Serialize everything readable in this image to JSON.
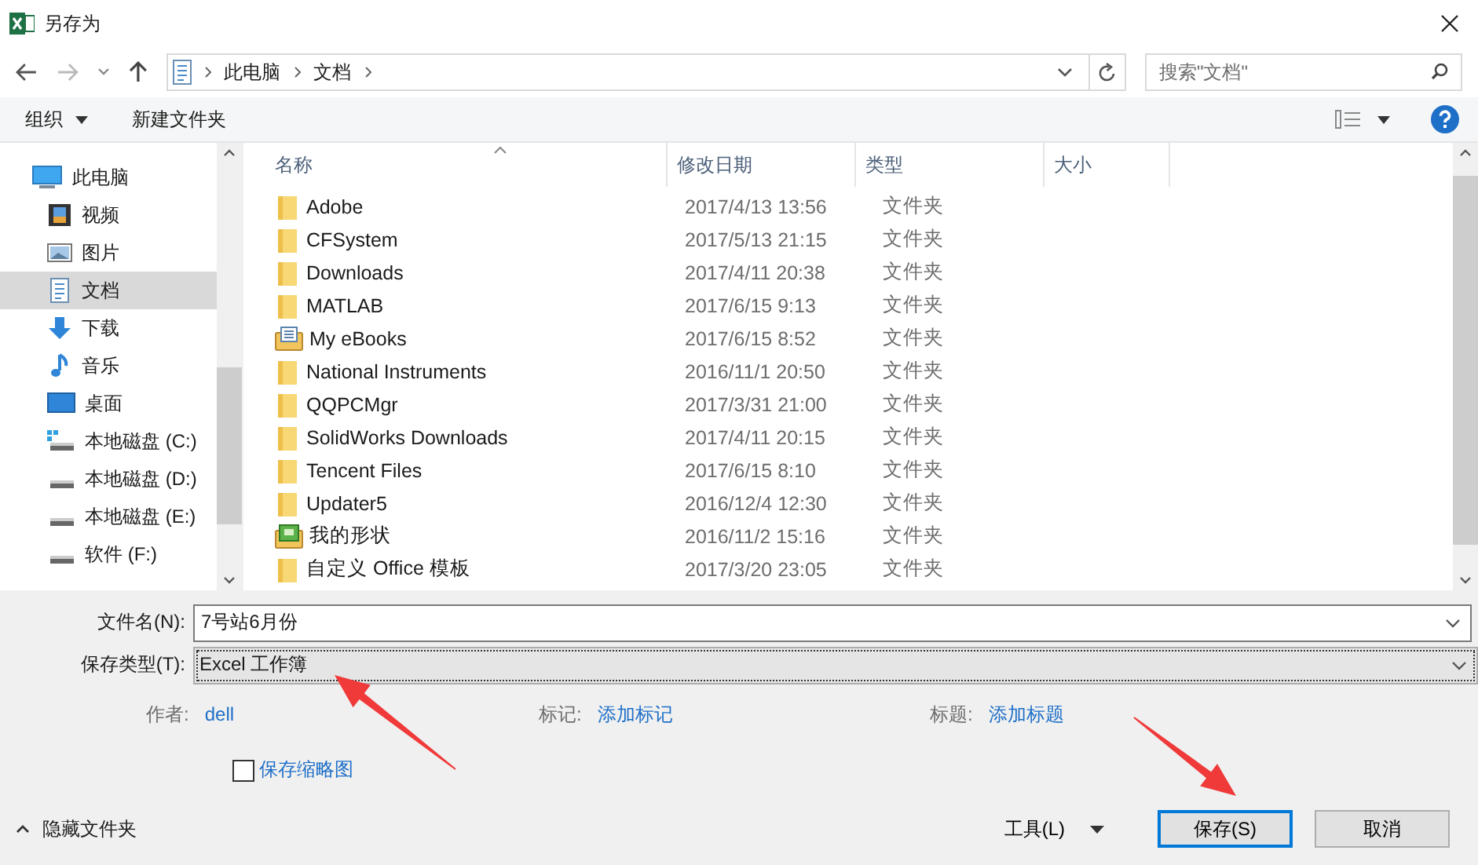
{
  "window": {
    "title": "另存为"
  },
  "nav": {
    "breadcrumb": [
      "此电脑",
      "文档"
    ],
    "search": {
      "placeholder": "搜索\"文档\""
    }
  },
  "toolbar": {
    "organize": "组织",
    "new_folder": "新建文件夹"
  },
  "sidebar": {
    "items": [
      {
        "label": "此电脑",
        "kind": "pc",
        "selected": false,
        "children": [
          {
            "label": "视频",
            "kind": "video",
            "selected": false
          },
          {
            "label": "图片",
            "kind": "picture",
            "selected": false
          },
          {
            "label": "文档",
            "kind": "document",
            "selected": true
          },
          {
            "label": "下载",
            "kind": "download",
            "selected": false
          },
          {
            "label": "音乐",
            "kind": "music",
            "selected": false
          },
          {
            "label": "桌面",
            "kind": "desktop",
            "selected": false
          },
          {
            "label": "本地磁盘 (C:)",
            "kind": "system-drive",
            "selected": false
          },
          {
            "label": "本地磁盘 (D:)",
            "kind": "drive",
            "selected": false
          },
          {
            "label": "本地磁盘 (E:)",
            "kind": "drive",
            "selected": false
          },
          {
            "label": "软件 (F:)",
            "kind": "drive",
            "selected": false
          }
        ]
      }
    ]
  },
  "table": {
    "columns": [
      "名称",
      "修改日期",
      "类型",
      "大小"
    ],
    "rows": [
      {
        "name": "Adobe",
        "date": "2017/4/13 13:56",
        "type": "文件夹",
        "kind": "folder"
      },
      {
        "name": "CFSystem",
        "date": "2017/5/13 21:15",
        "type": "文件夹",
        "kind": "folder"
      },
      {
        "name": "Downloads",
        "date": "2017/4/11 20:38",
        "type": "文件夹",
        "kind": "folder"
      },
      {
        "name": "MATLAB",
        "date": "2017/6/15 9:13",
        "type": "文件夹",
        "kind": "folder"
      },
      {
        "name": "My eBooks",
        "date": "2017/6/15 8:52",
        "type": "文件夹",
        "kind": "book-folder"
      },
      {
        "name": "National Instruments",
        "date": "2016/11/1 20:50",
        "type": "文件夹",
        "kind": "folder"
      },
      {
        "name": "QQPCMgr",
        "date": "2017/3/31 21:00",
        "type": "文件夹",
        "kind": "folder"
      },
      {
        "name": "SolidWorks Downloads",
        "date": "2017/4/11 20:15",
        "type": "文件夹",
        "kind": "folder"
      },
      {
        "name": "Tencent Files",
        "date": "2017/6/15 8:10",
        "type": "文件夹",
        "kind": "folder"
      },
      {
        "name": "Updater5",
        "date": "2016/12/4 12:30",
        "type": "文件夹",
        "kind": "folder"
      },
      {
        "name": "我的形状",
        "date": "2016/11/2 15:16",
        "type": "文件夹",
        "kind": "shapes-folder"
      },
      {
        "name": "自定义 Office 模板",
        "date": "2017/3/20 23:05",
        "type": "文件夹",
        "kind": "folder"
      }
    ]
  },
  "form": {
    "filename": {
      "label": "文件名(N):",
      "value": "7号站6月份"
    },
    "filetype": {
      "label": "保存类型(T):",
      "value": "Excel 工作簿"
    },
    "meta": [
      {
        "label": "作者:",
        "value": "dell"
      },
      {
        "label": "标记:",
        "value": "添加标记"
      },
      {
        "label": "标题:",
        "value": "添加标题"
      }
    ],
    "thumbnail": {
      "label": "保存缩略图",
      "checked": false
    }
  },
  "footer": {
    "hide_folders": "隐藏文件夹",
    "tools": "工具(L)",
    "save": "保存(S)",
    "cancel": "取消"
  },
  "annotations": [
    {
      "kind": "arrow"
    },
    {
      "kind": "arrow"
    }
  ]
}
